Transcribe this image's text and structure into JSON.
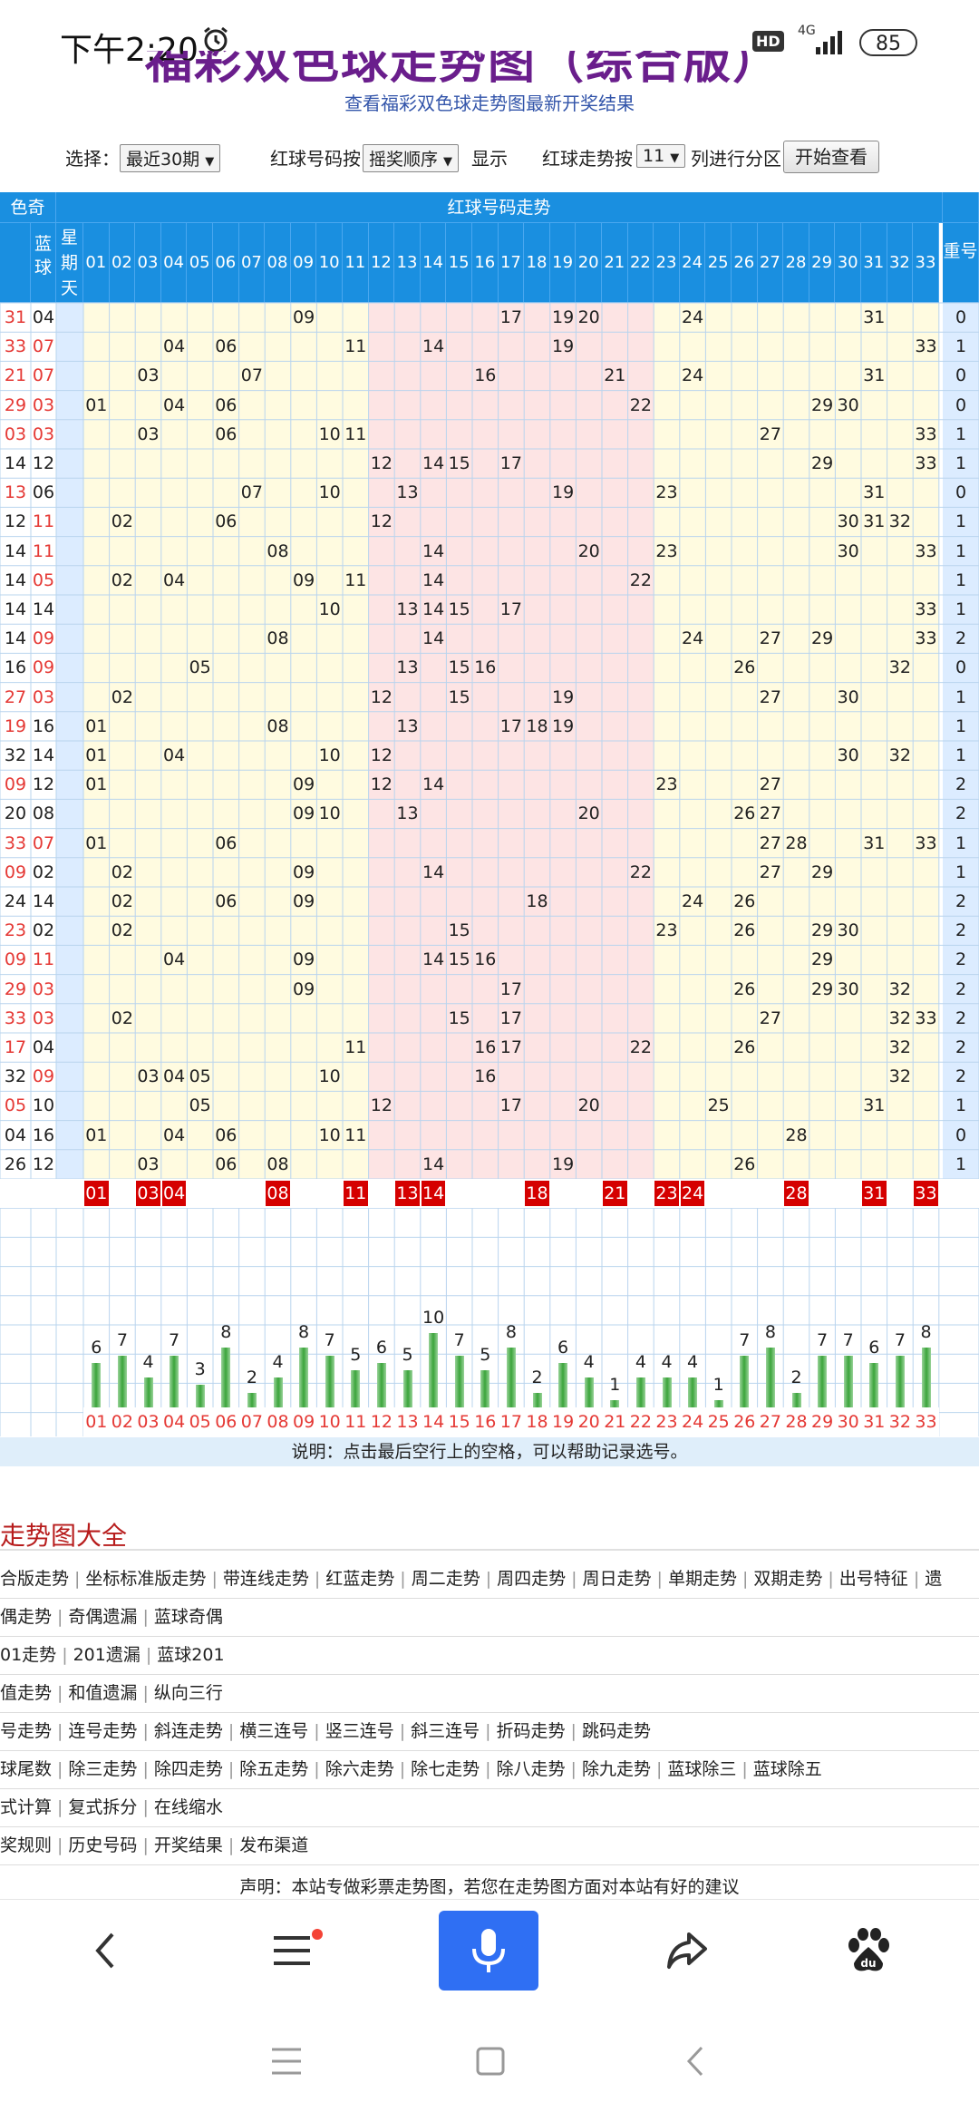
{
  "status": {
    "time": "下午2:20",
    "hd": "HD",
    "net": "4G",
    "battery": "85"
  },
  "header": {
    "title_fragment": "福彩双色球走势图（综合版）",
    "subtitle": "查看福彩双色球走势图最新开奖结果"
  },
  "controls": {
    "select_label": "选择：",
    "period_value": "最近30期",
    "redball_label": "红球号码按",
    "order_value": "摇奖顺序",
    "display_label": "显示",
    "trend_label": "红球走势按",
    "cols_value": "11",
    "cols_label": "列进行分区",
    "start_button": "开始查看"
  },
  "table": {
    "left_header": "色奇数)",
    "blue_header": "蓝球",
    "week_header": "星期天",
    "red_header": "红球号码走势",
    "repeat_header": "重号",
    "red_numbers": [
      "01",
      "02",
      "03",
      "04",
      "05",
      "06",
      "07",
      "08",
      "09",
      "10",
      "11",
      "12",
      "13",
      "14",
      "15",
      "16",
      "17",
      "18",
      "19",
      "20",
      "21",
      "22",
      "23",
      "24",
      "25",
      "26",
      "27",
      "28",
      "29",
      "30",
      "31",
      "32",
      "33"
    ],
    "rows": [
      {
        "a": "31",
        "b": "04",
        "red": [
          9,
          17,
          19,
          20,
          24,
          31
        ],
        "r": "0"
      },
      {
        "a": "33",
        "b": "07",
        "red": [
          4,
          6,
          11,
          14,
          19,
          33
        ],
        "r": "1"
      },
      {
        "a": "21",
        "b": "07",
        "red": [
          3,
          7,
          16,
          21,
          24,
          31
        ],
        "r": "0"
      },
      {
        "a": "29",
        "b": "03",
        "red": [
          1,
          4,
          6,
          22,
          29,
          30
        ],
        "r": "0"
      },
      {
        "a": "03",
        "b": "03",
        "red": [
          3,
          6,
          10,
          11,
          27,
          33
        ],
        "r": "1"
      },
      {
        "a": "14",
        "b": "12",
        "red": [
          12,
          14,
          15,
          17,
          29,
          33
        ],
        "r": "1"
      },
      {
        "a": "13",
        "b": "06",
        "red": [
          7,
          10,
          13,
          19,
          23,
          31
        ],
        "r": "0"
      },
      {
        "a": "12",
        "b": "11",
        "red": [
          2,
          6,
          12,
          30,
          31,
          32
        ],
        "r": "1"
      },
      {
        "a": "14",
        "b": "11",
        "red": [
          8,
          14,
          20,
          23,
          30,
          33
        ],
        "r": "1"
      },
      {
        "a": "14",
        "b": "05",
        "red": [
          2,
          4,
          9,
          11,
          14,
          22
        ],
        "r": "1"
      },
      {
        "a": "14",
        "b": "14",
        "red": [
          10,
          13,
          14,
          15,
          17,
          33
        ],
        "r": "1"
      },
      {
        "a": "14",
        "b": "09",
        "red": [
          8,
          14,
          24,
          27,
          29,
          33
        ],
        "r": "2"
      },
      {
        "a": "16",
        "b": "09",
        "red": [
          5,
          13,
          15,
          16,
          26,
          32
        ],
        "r": "0"
      },
      {
        "a": "27",
        "b": "03",
        "red": [
          2,
          12,
          15,
          19,
          27,
          30
        ],
        "r": "1"
      },
      {
        "a": "19",
        "b": "16",
        "red": [
          1,
          8,
          13,
          17,
          18,
          19
        ],
        "r": "1"
      },
      {
        "a": "32",
        "b": "14",
        "red": [
          1,
          4,
          10,
          12,
          30,
          32
        ],
        "r": "1"
      },
      {
        "a": "09",
        "b": "12",
        "red": [
          1,
          9,
          12,
          14,
          23,
          27
        ],
        "r": "2"
      },
      {
        "a": "20",
        "b": "08",
        "red": [
          9,
          10,
          13,
          20,
          26,
          27
        ],
        "r": "2"
      },
      {
        "a": "33",
        "b": "07",
        "red": [
          1,
          6,
          27,
          28,
          31,
          33
        ],
        "r": "1"
      },
      {
        "a": "09",
        "b": "02",
        "red": [
          2,
          9,
          14,
          22,
          27,
          29
        ],
        "r": "1"
      },
      {
        "a": "24",
        "b": "14",
        "red": [
          2,
          6,
          9,
          18,
          24,
          26
        ],
        "r": "2"
      },
      {
        "a": "23",
        "b": "02",
        "red": [
          2,
          15,
          23,
          26,
          29,
          30
        ],
        "r": "2"
      },
      {
        "a": "09",
        "b": "11",
        "red": [
          4,
          9,
          14,
          15,
          16,
          29
        ],
        "r": "2"
      },
      {
        "a": "29",
        "b": "03",
        "red": [
          9,
          17,
          26,
          29,
          30,
          32
        ],
        "r": "2"
      },
      {
        "a": "33",
        "b": "03",
        "red": [
          2,
          15,
          17,
          27,
          32,
          33
        ],
        "r": "2"
      },
      {
        "a": "17",
        "b": "04",
        "red": [
          11,
          16,
          17,
          22,
          26,
          32
        ],
        "r": "2"
      },
      {
        "a": "32",
        "b": "09",
        "red": [
          3,
          4,
          5,
          10,
          16,
          32
        ],
        "r": "2"
      },
      {
        "a": "05",
        "b": "10",
        "red": [
          5,
          12,
          17,
          20,
          25,
          31
        ],
        "r": "1"
      },
      {
        "a": "04",
        "b": "16",
        "red": [
          1,
          4,
          6,
          10,
          11,
          28
        ],
        "r": "0"
      },
      {
        "a": "26",
        "b": "12",
        "red": [
          3,
          6,
          8,
          14,
          19,
          26
        ],
        "r": "1"
      }
    ],
    "latest_selected": [
      1,
      3,
      4,
      8,
      11,
      13,
      14,
      18,
      21,
      23,
      24,
      28,
      31,
      33
    ],
    "frequency": [
      6,
      7,
      4,
      7,
      3,
      8,
      2,
      4,
      8,
      7,
      5,
      6,
      5,
      10,
      7,
      5,
      8,
      2,
      6,
      4,
      1,
      4,
      4,
      4,
      1,
      7,
      8,
      2,
      7,
      7,
      6,
      7,
      8
    ],
    "note": "说明：点击最后空行上的空格，可以帮助记录选号。"
  },
  "links": {
    "title": "走势图大全",
    "rows": [
      [
        "合版走势",
        "坐标标准版走势",
        "带连线走势",
        "红蓝走势",
        "周二走势",
        "周四走势",
        "周日走势",
        "单期走势",
        "双期走势",
        "出号特征",
        "遗"
      ],
      [
        "偶走势",
        "奇偶遗漏",
        "蓝球奇偶"
      ],
      [
        "01走势",
        "201遗漏",
        "蓝球201"
      ],
      [
        "值走势",
        "和值遗漏",
        "纵向三行"
      ],
      [
        "号走势",
        "连号走势",
        "斜连走势",
        "横三连号",
        "竖三连号",
        "斜三连号",
        "折码走势",
        "跳码走势"
      ],
      [
        "球尾数",
        "除三走势",
        "除四走势",
        "除五走势",
        "除六走势",
        "除七走势",
        "除八走势",
        "除九走势",
        "蓝球除三",
        "蓝球除五"
      ],
      [
        "式计算",
        "复式拆分",
        "在线缩水"
      ],
      [
        "奖规则",
        "历史号码",
        "开奖结果",
        "发布渠道"
      ]
    ],
    "declaration": "声明：本站专做彩票走势图，若您在走势图方面对本站有好的建议"
  },
  "icons": [
    "alarm-icon",
    "signal-icon",
    "back-icon",
    "menu-icon",
    "mic-icon",
    "share-icon",
    "baidu-icon",
    "nav-menu-icon",
    "nav-home-icon",
    "nav-back-icon"
  ],
  "colors": {
    "header_blue": "#1a8fe0",
    "zone_yellow": "#fffbe0",
    "zone_pink": "#fde4e4",
    "blue_col": "#dcecff",
    "mark_red": "#d50000",
    "bar_green": "#3aa43a"
  }
}
